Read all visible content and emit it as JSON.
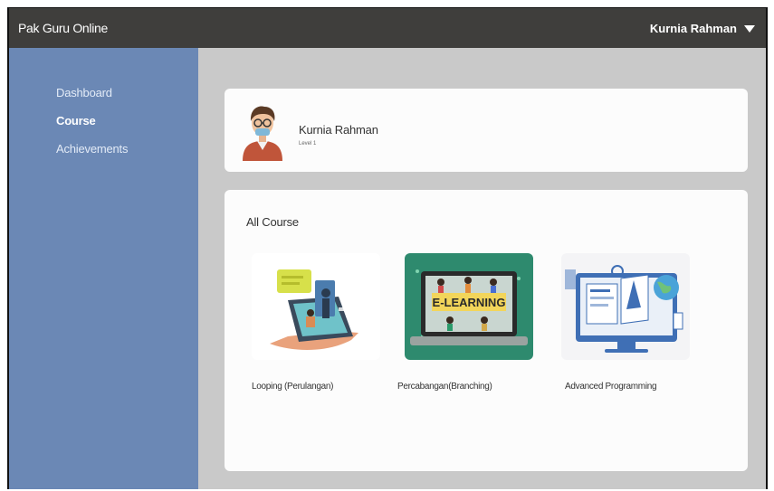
{
  "header": {
    "brand": "Pak Guru Online",
    "user_name": "Kurnia Rahman",
    "icons": {
      "user_menu": "caret-down-icon"
    }
  },
  "sidebar": {
    "items": [
      {
        "label": "Dashboard",
        "active": false
      },
      {
        "label": "Course",
        "active": true
      },
      {
        "label": "Achievements",
        "active": false
      }
    ]
  },
  "profile": {
    "name": "Kurnia Rahman",
    "level": "Level 1",
    "icon": "user-avatar-icon"
  },
  "courses": {
    "title": "All Course",
    "items": [
      {
        "label": "Looping (Perulangan)",
        "icon": "mobile-learning-illustration"
      },
      {
        "label": "Percabangan(Branching)",
        "icon": "e-learning-laptop-illustration",
        "banner": "E-LEARNING"
      },
      {
        "label": "Advanced Programming",
        "icon": "monitor-documents-illustration"
      }
    ]
  },
  "colors": {
    "topbar": "#3f3e3c",
    "sidebar": "#6b88b5",
    "content_bg": "#c9c9c9",
    "card": "#fcfcfc",
    "teal_thumb": "#2e8a6e"
  }
}
